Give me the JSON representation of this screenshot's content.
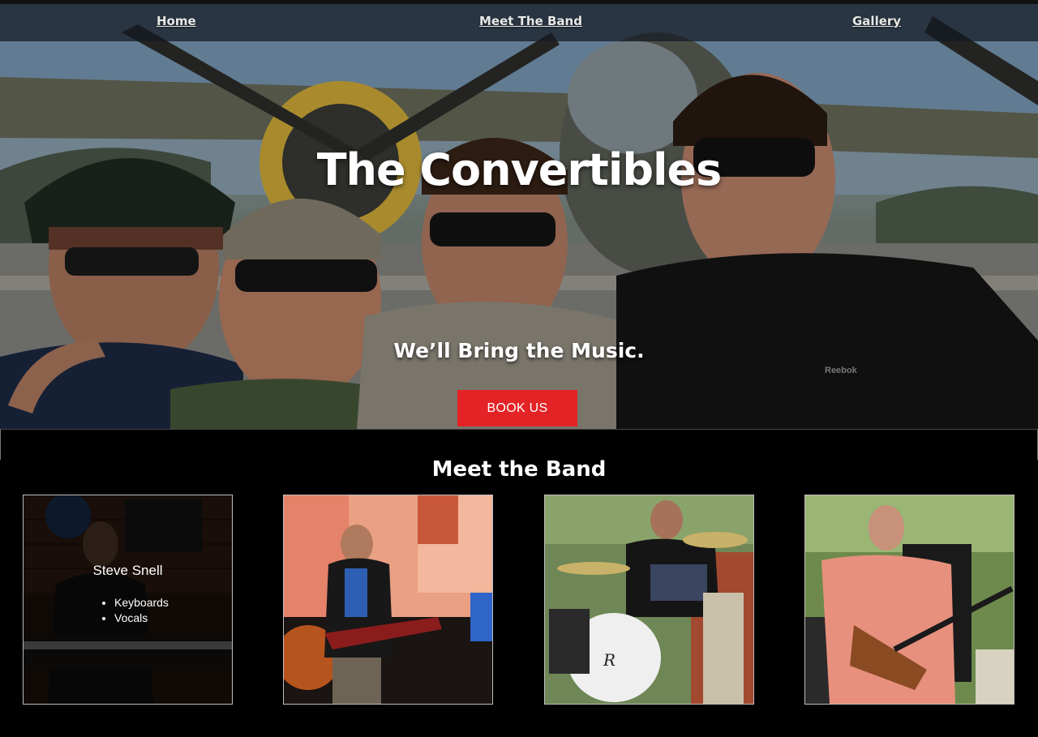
{
  "nav": {
    "home": "Home",
    "meet_the_band": "Meet The Band",
    "gallery": "Gallery"
  },
  "hero": {
    "title": "The Convertibles",
    "tagline": "We’ll Bring the Music.",
    "book_button": "BOOK US",
    "book_button_color": "#e32325",
    "shirt_brand": "Reebok"
  },
  "band": {
    "heading": "Meet the Band",
    "members": [
      {
        "name": "Steve Snell",
        "roles": [
          "Keyboards",
          "Vocals"
        ]
      }
    ],
    "drum_brand": "R"
  }
}
